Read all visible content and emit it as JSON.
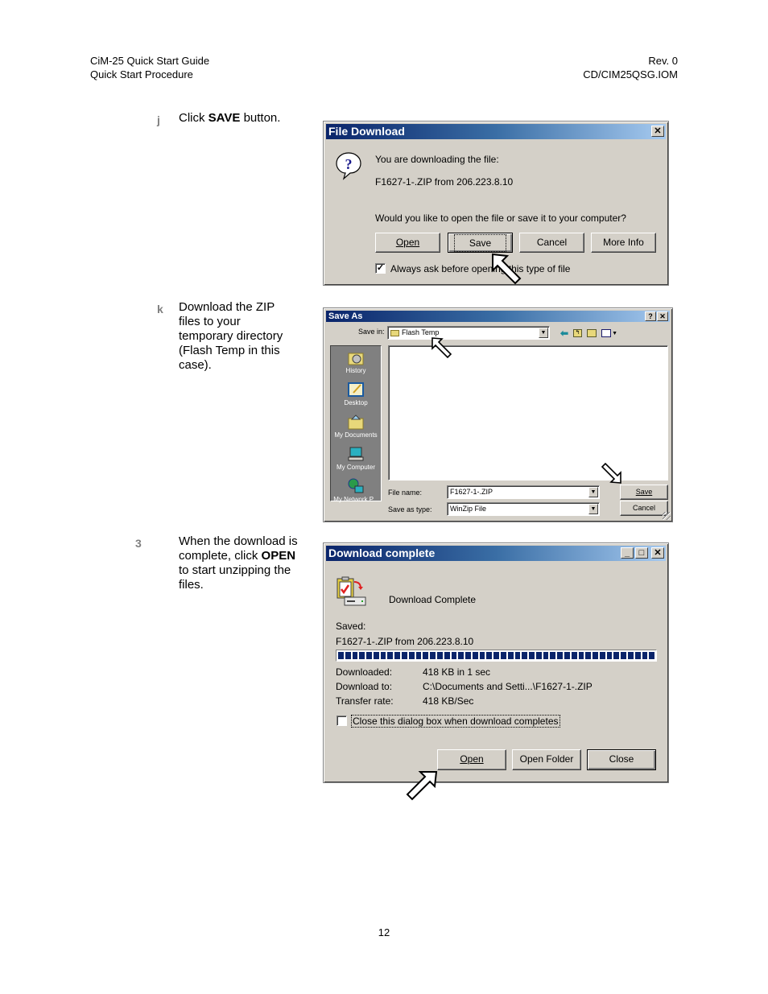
{
  "header": {
    "title": "CiM-25 Quick Start Guide",
    "section": "Quick Start Procedure",
    "revision": "Rev. 0",
    "doc_id": "CD/CIM25QSG.IOM"
  },
  "steps": [
    {
      "num": "j",
      "text_before": "Click ",
      "bold": "SAVE",
      "text_after": " button."
    },
    {
      "num": "k",
      "text": "Download the ZIP files to your temporary directory (Flash Temp in this case)."
    },
    {
      "num": "3",
      "text_before": "When the download is complete, click ",
      "bold": "OPEN",
      "text_after": " to start unzipping the files."
    }
  ],
  "file_download": {
    "title": "File Download",
    "line1": "You are downloading the file:",
    "line2": "F1627-1-.ZIP from 206.223.8.10",
    "question": "Would you like to open the file or save it to your computer?",
    "buttons": {
      "open": "Open",
      "save": "Save",
      "cancel": "Cancel",
      "more_info": "More Info"
    },
    "checkbox_label": "Always ask before opening this type of file",
    "checkbox_checked": true,
    "icon": "question-balloon-icon"
  },
  "save_as": {
    "title": "Save As",
    "save_in_label": "Save in:",
    "save_in_value": "Flash Temp",
    "places": [
      "History",
      "Desktop",
      "My Documents",
      "My Computer",
      "My Network P..."
    ],
    "file_name_label": "File name:",
    "file_name_value": "F1627-1-.ZIP",
    "save_as_type_label": "Save as type:",
    "save_as_type_value": "WinZip File",
    "buttons": {
      "save": "Save",
      "cancel": "Cancel"
    },
    "toolbar_icons": [
      "back-icon",
      "up-folder-icon",
      "new-folder-icon",
      "view-menu-icon"
    ]
  },
  "download_complete": {
    "title": "Download complete",
    "heading": "Download Complete",
    "saved_label": "Saved:",
    "saved_value": "F1627-1-.ZIP from 206.223.8.10",
    "progress_percent": 100,
    "rows": [
      {
        "label": "Downloaded:",
        "value": "418 KB in 1 sec"
      },
      {
        "label": "Download to:",
        "value": "C:\\Documents and Setti...\\F1627-1-.ZIP"
      },
      {
        "label": "Transfer rate:",
        "value": "418 KB/Sec"
      }
    ],
    "checkbox_label": "Close this dialog box when download completes",
    "checkbox_checked": false,
    "buttons": {
      "open": "Open",
      "open_folder": "Open Folder",
      "close": "Close"
    }
  },
  "footer": {
    "page_number": "12"
  }
}
